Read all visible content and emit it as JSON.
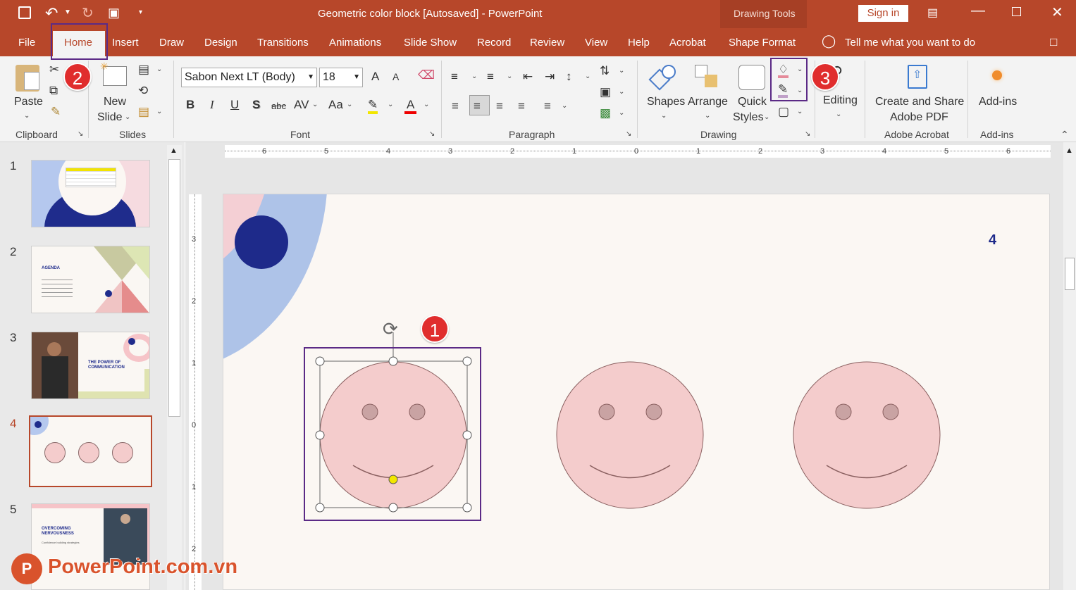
{
  "window": {
    "title": "Geometric color block [Autosaved]  -  PowerPoint",
    "context_tab": "Drawing Tools",
    "sign_in": "Sign in"
  },
  "tabs": [
    "File",
    "Home",
    "Insert",
    "Draw",
    "Design",
    "Transitions",
    "Animations",
    "Slide Show",
    "Record",
    "Review",
    "View",
    "Help",
    "Acrobat",
    "Shape Format"
  ],
  "tell_me": "Tell me what you want to do",
  "ribbon": {
    "clipboard": {
      "paste": "Paste",
      "group": "Clipboard"
    },
    "slides": {
      "new_slide_1": "New",
      "new_slide_2": "Slide",
      "group": "Slides"
    },
    "font": {
      "name": "Sabon Next LT (Body)",
      "size": "18",
      "group": "Font",
      "bold": "B",
      "italic": "I",
      "underline": "U",
      "shadow": "S",
      "strike": "abc",
      "spacing": "AV",
      "case": "Aa",
      "grow": "A",
      "shrink": "A",
      "color": "A"
    },
    "paragraph": {
      "group": "Paragraph"
    },
    "drawing": {
      "shapes": "Shapes",
      "arrange": "Arrange",
      "quick_1": "Quick",
      "quick_2": "Styles",
      "group": "Drawing"
    },
    "editing": {
      "label": "Editing"
    },
    "acrobat": {
      "line1": "Create and Share",
      "line2": "Adobe PDF",
      "group": "Adobe Acrobat"
    },
    "addins": {
      "label": "Add-ins",
      "group": "Add-ins"
    }
  },
  "slides": [
    {
      "num": "1"
    },
    {
      "num": "2",
      "agenda_title": "AGENDA"
    },
    {
      "num": "3",
      "text": "THE POWER OF COMMUNICATION"
    },
    {
      "num": "4"
    },
    {
      "num": "5",
      "title": "OVERCOMING NERVOUSNESS",
      "subtitle": "Confidence building strategies"
    }
  ],
  "slide_number": "4",
  "ruler_h": [
    "6",
    "5",
    "4",
    "3",
    "2",
    "1",
    "0",
    "1",
    "2",
    "3",
    "4",
    "5",
    "6"
  ],
  "ruler_v": [
    "3",
    "2",
    "1",
    "0",
    "1",
    "2"
  ],
  "badges": [
    "1",
    "2",
    "3"
  ],
  "watermark": "PowerPoint.com.vn",
  "colors": {
    "accent": "#b7472a",
    "highlight": "#5b2a86",
    "badge": "#e02d2d",
    "face": "#f4cccc",
    "navy": "#1e2a8a",
    "blue": "#aec3e8"
  }
}
